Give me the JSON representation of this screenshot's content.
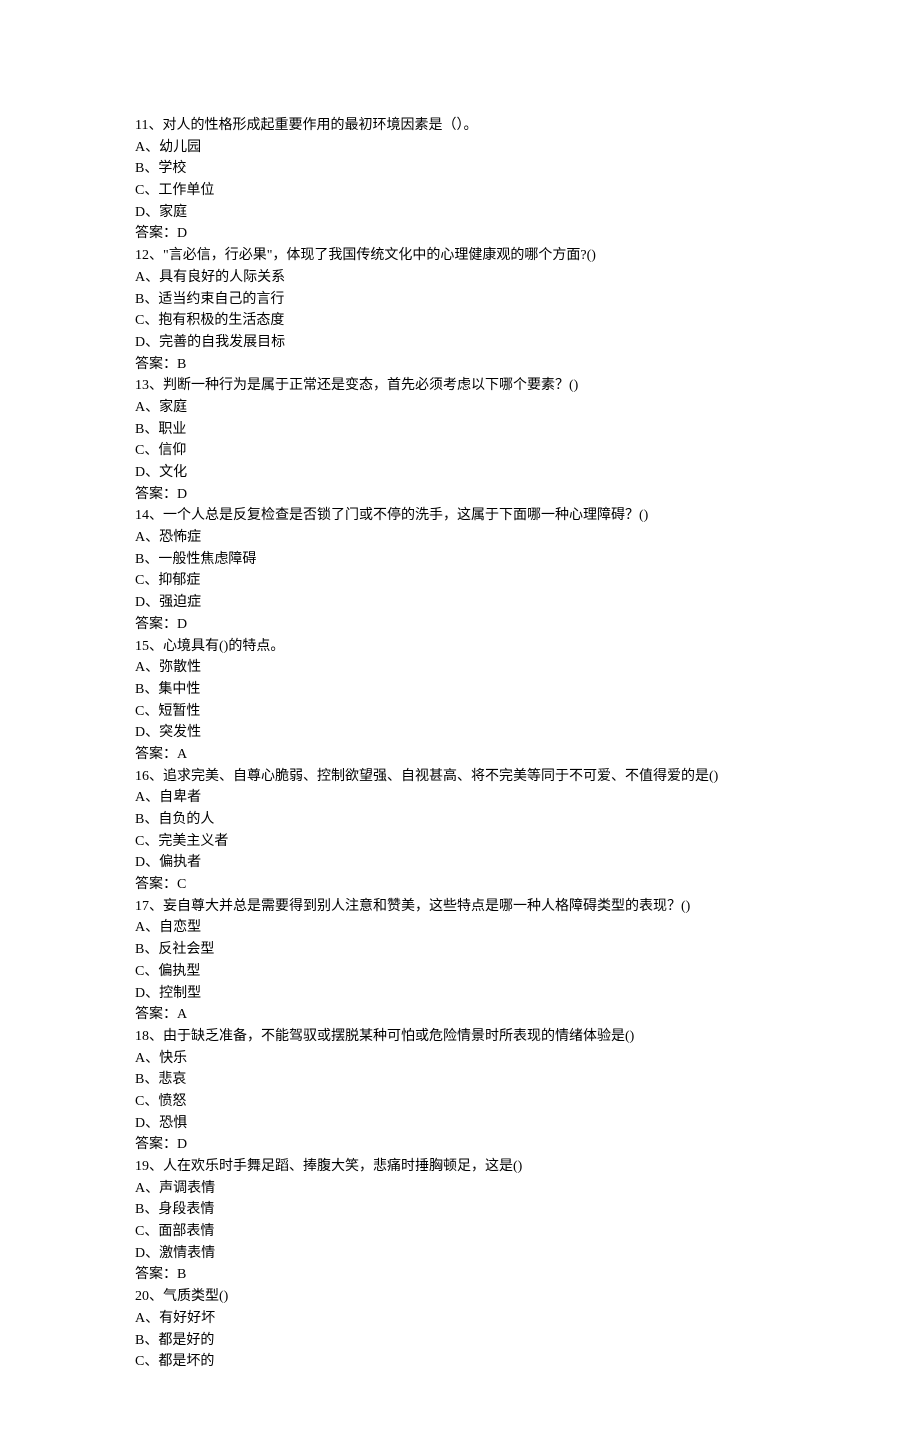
{
  "questions": [
    {
      "number": "11",
      "text": "、对人的性格形成起重要作用的最初环境因素是（）。",
      "options": [
        {
          "label": "A",
          "text": "、幼儿园"
        },
        {
          "label": "B",
          "text": "、学校"
        },
        {
          "label": "C",
          "text": "、工作单位"
        },
        {
          "label": "D",
          "text": "、家庭"
        }
      ],
      "answer_label": "答案：",
      "answer": "D"
    },
    {
      "number": "12",
      "text": "、\"言必信，行必果\"，体现了我国传统文化中的心理健康观的哪个方面?()",
      "options": [
        {
          "label": "A",
          "text": "、具有良好的人际关系"
        },
        {
          "label": "B",
          "text": "、适当约束自己的言行"
        },
        {
          "label": "C",
          "text": "、抱有积极的生活态度"
        },
        {
          "label": "D",
          "text": "、完善的自我发展目标"
        }
      ],
      "answer_label": "答案：",
      "answer": "B"
    },
    {
      "number": "13",
      "text": "、判断一种行为是属于正常还是变态，首先必须考虑以下哪个要素？()",
      "options": [
        {
          "label": "A",
          "text": "、家庭"
        },
        {
          "label": "B",
          "text": "、职业"
        },
        {
          "label": "C",
          "text": "、信仰"
        },
        {
          "label": "D",
          "text": "、文化"
        }
      ],
      "answer_label": "答案：",
      "answer": "D"
    },
    {
      "number": "14",
      "text": "、一个人总是反复检查是否锁了门或不停的洗手，这属于下面哪一种心理障碍？()",
      "options": [
        {
          "label": "A",
          "text": "、恐怖症"
        },
        {
          "label": "B",
          "text": "、一般性焦虑障碍"
        },
        {
          "label": "C",
          "text": "、抑郁症"
        },
        {
          "label": "D",
          "text": "、强迫症"
        }
      ],
      "answer_label": "答案：",
      "answer": "D"
    },
    {
      "number": "15",
      "text": "、心境具有()的特点。",
      "options": [
        {
          "label": "A",
          "text": "、弥散性"
        },
        {
          "label": "B",
          "text": "、集中性"
        },
        {
          "label": "C",
          "text": "、短暂性"
        },
        {
          "label": "D",
          "text": "、突发性"
        }
      ],
      "answer_label": "答案：",
      "answer": "A"
    },
    {
      "number": "16",
      "text": "、追求完美、自尊心脆弱、控制欲望强、自视甚高、将不完美等同于不可爱、不值得爱的是()",
      "options": [
        {
          "label": "A",
          "text": "、自卑者"
        },
        {
          "label": "B",
          "text": "、自负的人"
        },
        {
          "label": "C",
          "text": "、完美主义者"
        },
        {
          "label": "D",
          "text": "、偏执者"
        }
      ],
      "answer_label": "答案：",
      "answer": "C"
    },
    {
      "number": "17",
      "text": "、妄自尊大并总是需要得到别人注意和赞美，这些特点是哪一种人格障碍类型的表现？()",
      "options": [
        {
          "label": "A",
          "text": "、自恋型"
        },
        {
          "label": "B",
          "text": "、反社会型"
        },
        {
          "label": "C",
          "text": "、偏执型"
        },
        {
          "label": "D",
          "text": "、控制型"
        }
      ],
      "answer_label": "答案：",
      "answer": "A"
    },
    {
      "number": "18",
      "text": "、由于缺乏准备，不能驾驭或摆脱某种可怕或危险情景时所表现的情绪体验是()",
      "options": [
        {
          "label": "A",
          "text": "、快乐"
        },
        {
          "label": "B",
          "text": "、悲哀"
        },
        {
          "label": "C",
          "text": "、愤怒"
        },
        {
          "label": "D",
          "text": "、恐惧"
        }
      ],
      "answer_label": "答案：",
      "answer": "D"
    },
    {
      "number": "19",
      "text": "、人在欢乐时手舞足蹈、捧腹大笑，悲痛时捶胸顿足，这是()",
      "options": [
        {
          "label": "A",
          "text": "、声调表情"
        },
        {
          "label": "B",
          "text": "、身段表情"
        },
        {
          "label": "C",
          "text": "、面部表情"
        },
        {
          "label": "D",
          "text": "、激情表情"
        }
      ],
      "answer_label": "答案：",
      "answer": "B"
    },
    {
      "number": "20",
      "text": "、气质类型()",
      "options": [
        {
          "label": "A",
          "text": "、有好好坏"
        },
        {
          "label": "B",
          "text": "、都是好的"
        },
        {
          "label": "C",
          "text": "、都是坏的"
        }
      ],
      "answer_label": null,
      "answer": null
    }
  ]
}
